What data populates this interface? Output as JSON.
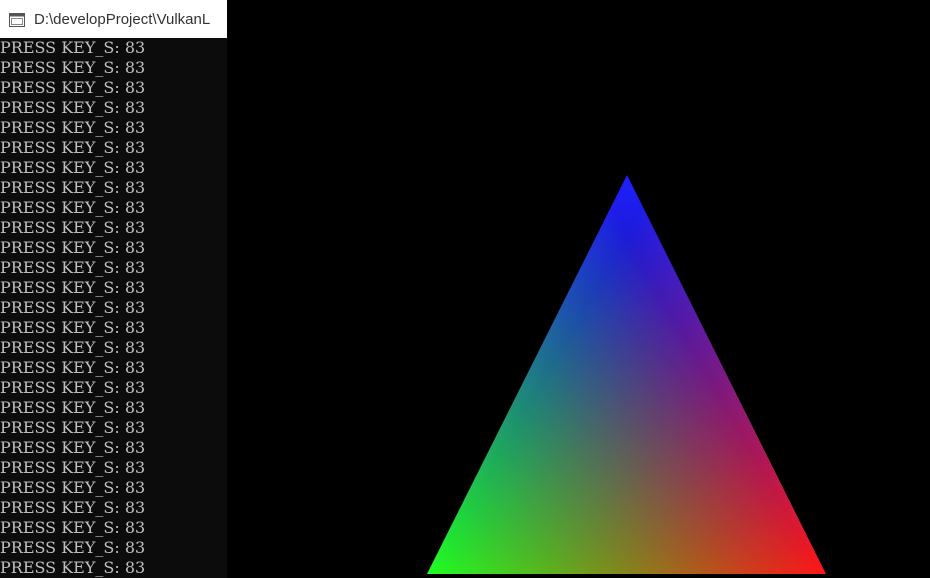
{
  "console": {
    "title": "D:\\developProject\\VulkanL",
    "icon": "console-window-icon",
    "line_text": "PRESS KEY_S: 83",
    "line_count": 27,
    "text_color": "#c0c0c0",
    "background": "#0c0c0c"
  },
  "render": {
    "background": "#000000",
    "shape": "triangle",
    "vertex_colors": {
      "top": "#2020ff",
      "bottom_left": "#22ff22",
      "bottom_right": "#ff1818"
    }
  }
}
